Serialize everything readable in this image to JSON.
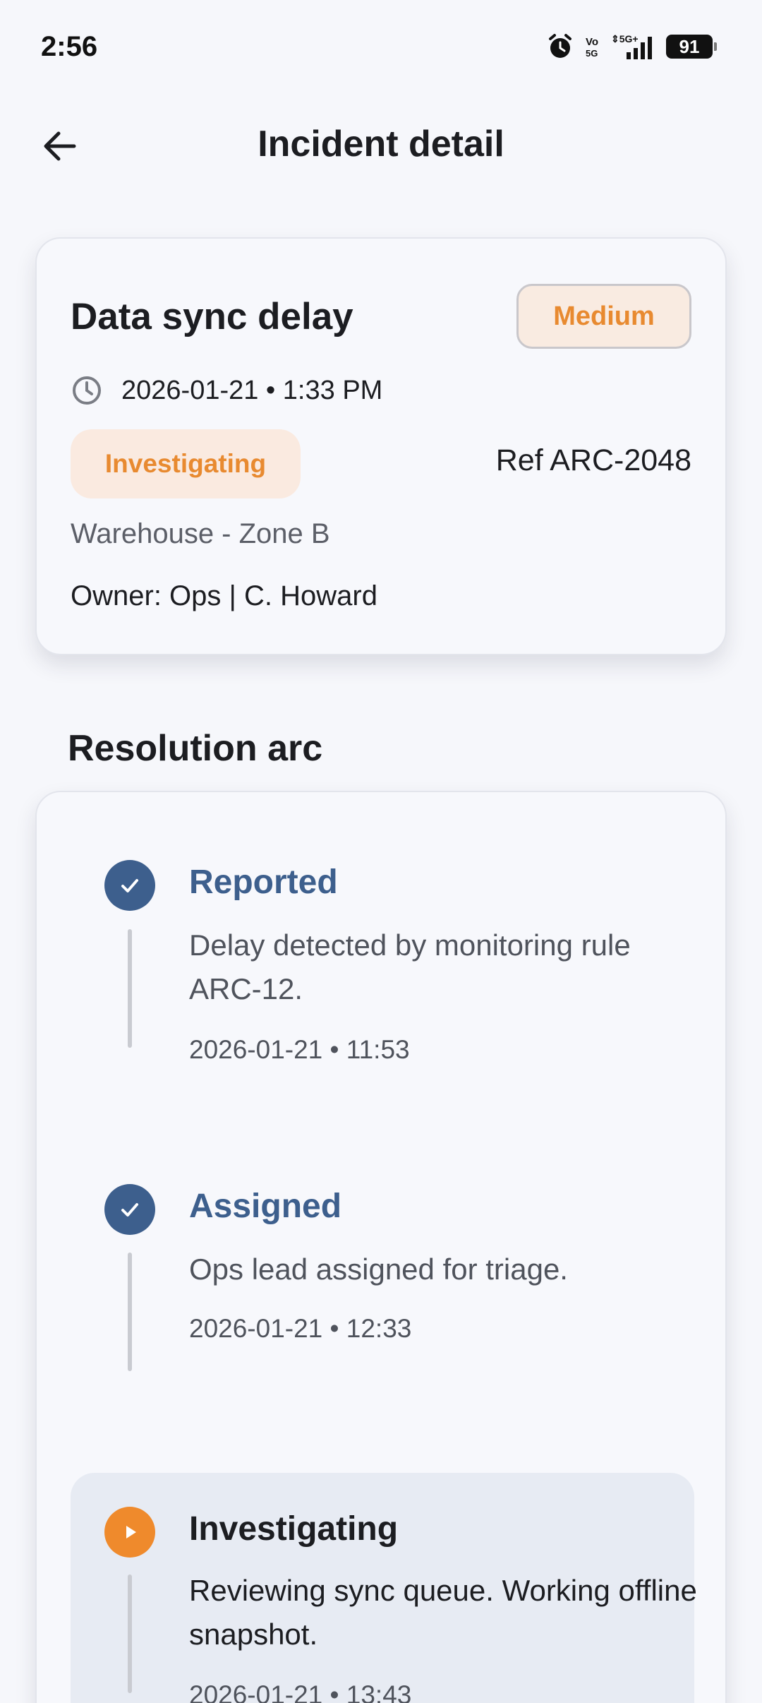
{
  "status_bar": {
    "time": "2:56",
    "battery": "91",
    "icons": [
      "alarm-icon",
      "volte-icon",
      "5g-signal-icon",
      "battery-icon"
    ]
  },
  "header": {
    "title": "Incident detail",
    "back_icon": "arrow-left-icon"
  },
  "incident": {
    "title": "Data sync delay",
    "severity": "Medium",
    "datetime": "2026-01-21 • 1:33 PM",
    "status": "Investigating",
    "ref": "Ref ARC-2048",
    "location": "Warehouse - Zone B",
    "owner": "Owner: Ops | C. Howard"
  },
  "resolution": {
    "section_title": "Resolution arc",
    "steps": [
      {
        "title": "Reported",
        "description": "Delay detected by monitoring rule ARC-12.",
        "time": "2026-01-21 • 11:53",
        "state": "done"
      },
      {
        "title": "Assigned",
        "description": "Ops lead assigned for triage.",
        "time": "2026-01-21 • 12:33",
        "state": "done"
      },
      {
        "title": "Investigating",
        "description": "Reviewing sync queue. Working offline snapshot.",
        "time": "2026-01-21 • 13:43",
        "state": "active"
      }
    ]
  },
  "colors": {
    "accent_blue": "#3d5f8d",
    "accent_orange": "#e88a30",
    "background": "#f6f7fb"
  }
}
